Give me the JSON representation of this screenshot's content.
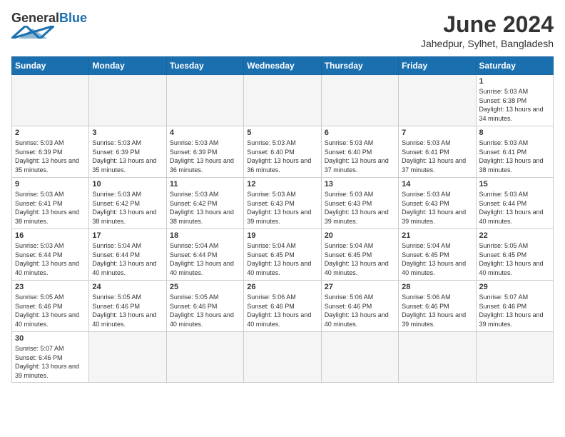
{
  "header": {
    "logo_general": "General",
    "logo_blue": "Blue",
    "month_title": "June 2024",
    "subtitle": "Jahedpur, Sylhet, Bangladesh"
  },
  "weekdays": [
    "Sunday",
    "Monday",
    "Tuesday",
    "Wednesday",
    "Thursday",
    "Friday",
    "Saturday"
  ],
  "weeks": [
    [
      {
        "day": "",
        "empty": true
      },
      {
        "day": "",
        "empty": true
      },
      {
        "day": "",
        "empty": true
      },
      {
        "day": "",
        "empty": true
      },
      {
        "day": "",
        "empty": true
      },
      {
        "day": "",
        "empty": true
      },
      {
        "day": "1",
        "sunrise": "5:03 AM",
        "sunset": "6:38 PM",
        "daylight": "13 hours and 34 minutes."
      }
    ],
    [
      {
        "day": "2",
        "sunrise": "5:03 AM",
        "sunset": "6:39 PM",
        "daylight": "13 hours and 35 minutes."
      },
      {
        "day": "3",
        "sunrise": "5:03 AM",
        "sunset": "6:39 PM",
        "daylight": "13 hours and 35 minutes."
      },
      {
        "day": "4",
        "sunrise": "5:03 AM",
        "sunset": "6:39 PM",
        "daylight": "13 hours and 36 minutes."
      },
      {
        "day": "5",
        "sunrise": "5:03 AM",
        "sunset": "6:40 PM",
        "daylight": "13 hours and 36 minutes."
      },
      {
        "day": "6",
        "sunrise": "5:03 AM",
        "sunset": "6:40 PM",
        "daylight": "13 hours and 37 minutes."
      },
      {
        "day": "7",
        "sunrise": "5:03 AM",
        "sunset": "6:41 PM",
        "daylight": "13 hours and 37 minutes."
      },
      {
        "day": "8",
        "sunrise": "5:03 AM",
        "sunset": "6:41 PM",
        "daylight": "13 hours and 38 minutes."
      }
    ],
    [
      {
        "day": "9",
        "sunrise": "5:03 AM",
        "sunset": "6:41 PM",
        "daylight": "13 hours and 38 minutes."
      },
      {
        "day": "10",
        "sunrise": "5:03 AM",
        "sunset": "6:42 PM",
        "daylight": "13 hours and 38 minutes."
      },
      {
        "day": "11",
        "sunrise": "5:03 AM",
        "sunset": "6:42 PM",
        "daylight": "13 hours and 38 minutes."
      },
      {
        "day": "12",
        "sunrise": "5:03 AM",
        "sunset": "6:43 PM",
        "daylight": "13 hours and 39 minutes."
      },
      {
        "day": "13",
        "sunrise": "5:03 AM",
        "sunset": "6:43 PM",
        "daylight": "13 hours and 39 minutes."
      },
      {
        "day": "14",
        "sunrise": "5:03 AM",
        "sunset": "6:43 PM",
        "daylight": "13 hours and 39 minutes."
      },
      {
        "day": "15",
        "sunrise": "5:03 AM",
        "sunset": "6:44 PM",
        "daylight": "13 hours and 40 minutes."
      }
    ],
    [
      {
        "day": "16",
        "sunrise": "5:03 AM",
        "sunset": "6:44 PM",
        "daylight": "13 hours and 40 minutes."
      },
      {
        "day": "17",
        "sunrise": "5:04 AM",
        "sunset": "6:44 PM",
        "daylight": "13 hours and 40 minutes."
      },
      {
        "day": "18",
        "sunrise": "5:04 AM",
        "sunset": "6:44 PM",
        "daylight": "13 hours and 40 minutes."
      },
      {
        "day": "19",
        "sunrise": "5:04 AM",
        "sunset": "6:45 PM",
        "daylight": "13 hours and 40 minutes."
      },
      {
        "day": "20",
        "sunrise": "5:04 AM",
        "sunset": "6:45 PM",
        "daylight": "13 hours and 40 minutes."
      },
      {
        "day": "21",
        "sunrise": "5:04 AM",
        "sunset": "6:45 PM",
        "daylight": "13 hours and 40 minutes."
      },
      {
        "day": "22",
        "sunrise": "5:05 AM",
        "sunset": "6:45 PM",
        "daylight": "13 hours and 40 minutes."
      }
    ],
    [
      {
        "day": "23",
        "sunrise": "5:05 AM",
        "sunset": "6:46 PM",
        "daylight": "13 hours and 40 minutes."
      },
      {
        "day": "24",
        "sunrise": "5:05 AM",
        "sunset": "6:46 PM",
        "daylight": "13 hours and 40 minutes."
      },
      {
        "day": "25",
        "sunrise": "5:05 AM",
        "sunset": "6:46 PM",
        "daylight": "13 hours and 40 minutes."
      },
      {
        "day": "26",
        "sunrise": "5:06 AM",
        "sunset": "6:46 PM",
        "daylight": "13 hours and 40 minutes."
      },
      {
        "day": "27",
        "sunrise": "5:06 AM",
        "sunset": "6:46 PM",
        "daylight": "13 hours and 40 minutes."
      },
      {
        "day": "28",
        "sunrise": "5:06 AM",
        "sunset": "6:46 PM",
        "daylight": "13 hours and 39 minutes."
      },
      {
        "day": "29",
        "sunrise": "5:07 AM",
        "sunset": "6:46 PM",
        "daylight": "13 hours and 39 minutes."
      }
    ],
    [
      {
        "day": "30",
        "sunrise": "5:07 AM",
        "sunset": "6:46 PM",
        "daylight": "13 hours and 39 minutes."
      },
      {
        "day": "",
        "empty": true
      },
      {
        "day": "",
        "empty": true
      },
      {
        "day": "",
        "empty": true
      },
      {
        "day": "",
        "empty": true
      },
      {
        "day": "",
        "empty": true
      },
      {
        "day": "",
        "empty": true
      }
    ]
  ]
}
